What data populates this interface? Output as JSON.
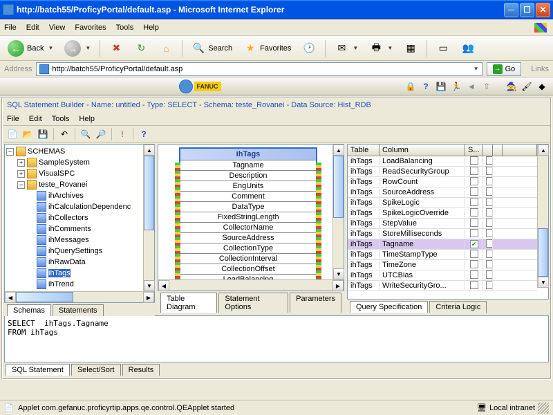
{
  "window": {
    "title": "http://batch55/ProficyPortal/default.asp - Microsoft Internet Explorer"
  },
  "menubar": [
    "File",
    "Edit",
    "View",
    "Favorites",
    "Tools",
    "Help"
  ],
  "toolbar": {
    "back": "Back",
    "search": "Search",
    "favorites": "Favorites"
  },
  "address": {
    "label": "Address",
    "url": "http://batch55/ProficyPortal/default.asp",
    "go": "Go",
    "links": "Links"
  },
  "logo": {
    "fanuc": "FANUC"
  },
  "sql": {
    "title": "SQL Statement Builder - Name: untitled - Type: SELECT - Schema: teste_Rovanei - Data Source: Hist_RDB",
    "menu": [
      "File",
      "Edit",
      "Tools",
      "Help"
    ]
  },
  "tree": {
    "root": "SCHEMAS",
    "schemas": [
      {
        "name": "SampleSystem",
        "expanded": false,
        "toggle": "+"
      },
      {
        "name": "VisualSPC",
        "expanded": false,
        "toggle": "+"
      },
      {
        "name": "teste_Rovanei",
        "expanded": true,
        "toggle": "−",
        "tables": [
          "ihArchives",
          "ihCalculationDependenc",
          "ihCollectors",
          "ihComments",
          "ihMessages",
          "ihQuerySettings",
          "ihRawData",
          "ihTags",
          "ihTrend"
        ]
      }
    ],
    "selected": "ihTags"
  },
  "left_tabs": [
    "Schemas",
    "Statements"
  ],
  "mid_tabs": [
    "Table Diagram",
    "Statement Options",
    "Parameters"
  ],
  "right_tabs": [
    "Query Specification",
    "Criteria Logic"
  ],
  "diagram": {
    "title": "ihTags",
    "rows": [
      "Tagname",
      "Description",
      "EngUnits",
      "Comment",
      "DataType",
      "FixedStringLength",
      "CollectorName",
      "SourceAddress",
      "CollectionType",
      "CollectionInterval",
      "CollectionOffset",
      "LoadBalancing"
    ]
  },
  "grid": {
    "headers": {
      "table": "Table",
      "column": "Column",
      "s": "S..."
    },
    "rows": [
      {
        "table": "ihTags",
        "column": "LoadBalancing",
        "checked": false
      },
      {
        "table": "ihTags",
        "column": "ReadSecurityGroup",
        "checked": false
      },
      {
        "table": "ihTags",
        "column": "RowCount",
        "checked": false
      },
      {
        "table": "ihTags",
        "column": "SourceAddress",
        "checked": false
      },
      {
        "table": "ihTags",
        "column": "SpikeLogic",
        "checked": false
      },
      {
        "table": "ihTags",
        "column": "SpikeLogicOverride",
        "checked": false
      },
      {
        "table": "ihTags",
        "column": "StepValue",
        "checked": false
      },
      {
        "table": "ihTags",
        "column": "StoreMilliseconds",
        "checked": false
      },
      {
        "table": "ihTags",
        "column": "Tagname",
        "checked": true,
        "selected": true
      },
      {
        "table": "ihTags",
        "column": "TimeStampType",
        "checked": false
      },
      {
        "table": "ihTags",
        "column": "TimeZone",
        "checked": false
      },
      {
        "table": "ihTags",
        "column": "UTCBias",
        "checked": false
      },
      {
        "table": "ihTags",
        "column": "WriteSecurityGro...",
        "checked": false
      }
    ]
  },
  "sql_text": "SELECT  ihTags.Tagname\nFROM ihTags",
  "output_tabs": [
    "SQL Statement",
    "Select/Sort",
    "Results"
  ],
  "status": {
    "text": "Applet com.gefanuc.proficyrtip.apps.qe.control.QEApplet started",
    "zone": "Local intranet"
  }
}
